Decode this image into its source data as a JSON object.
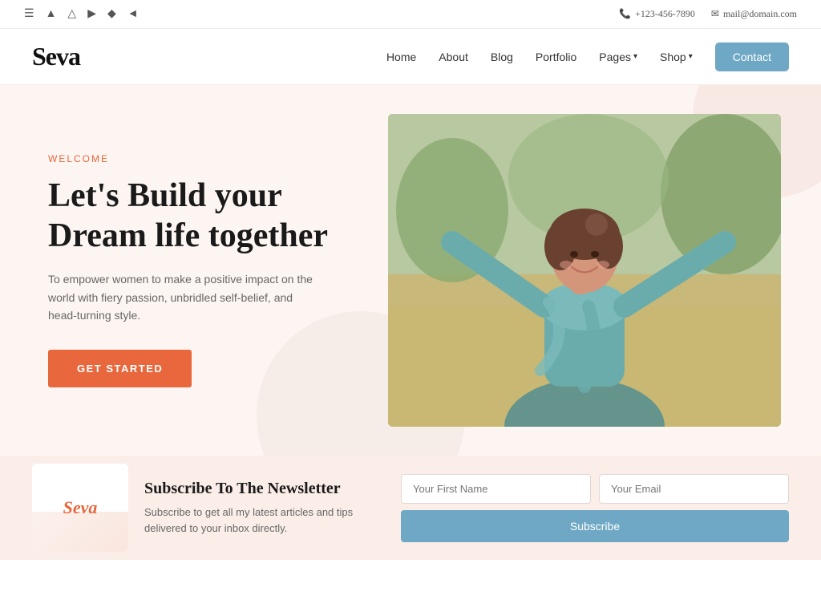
{
  "topbar": {
    "phone": "+123-456-7890",
    "email": "mail@domain.com",
    "icons": [
      "menu-icon",
      "facebook-icon",
      "instagram-icon",
      "youtube-icon",
      "pinterest-icon",
      "twitter-icon"
    ]
  },
  "header": {
    "logo": "Seva",
    "nav": {
      "home": "Home",
      "about": "About",
      "blog": "Blog",
      "portfolio": "Portfolio",
      "pages": "Pages",
      "shop": "Shop",
      "contact": "Contact"
    }
  },
  "hero": {
    "welcome_label": "Welcome",
    "title_line1": "Let's Build your",
    "title_line2": "Dream life together",
    "description": "To empower women to make a positive impact on the world with fiery passion, unbridled self-belief, and head-turning style.",
    "cta_button": "GET STARTED"
  },
  "newsletter": {
    "logo": "Seva",
    "title": "Subscribe To The Newsletter",
    "description": "Subscribe to get all my latest articles and tips delivered to your inbox directly.",
    "first_name_placeholder": "Your First Name",
    "email_placeholder": "Your Email",
    "subscribe_button": "Subscribe"
  },
  "colors": {
    "accent_orange": "#e8673c",
    "accent_blue": "#6fa8c4",
    "bg_light": "#fdf5f2",
    "bg_newsletter": "#fbeee8"
  }
}
